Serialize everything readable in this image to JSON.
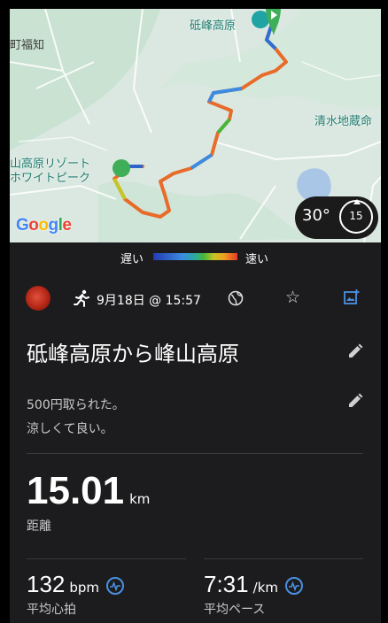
{
  "map": {
    "labels": {
      "town": "町福知",
      "summit": "砥峰高原",
      "shimizu": "清水地蔵命",
      "resort_line1": "山高原リゾート",
      "resort_line2": "ホワイトピーク"
    },
    "provider": "Google",
    "weather": {
      "temperature": "30°",
      "wind": "15"
    }
  },
  "legend": {
    "slow": "遅い",
    "fast": "速い"
  },
  "activity": {
    "date": "9月18日 @ 15:57",
    "title": "砥峰高原から峰山高原",
    "description_line1": "500円取られた。",
    "description_line2": "涼しくて良い。",
    "distance": {
      "value": "15.01",
      "unit": "km",
      "label": "距離"
    },
    "heart_rate": {
      "value": "132",
      "unit": "bpm",
      "label": "平均心拍"
    },
    "pace": {
      "value": "7:31",
      "unit": "/km",
      "label": "平均ペース"
    }
  },
  "colors": {
    "accent_blue": "#4a90e2",
    "background": "#1c1c1e"
  }
}
